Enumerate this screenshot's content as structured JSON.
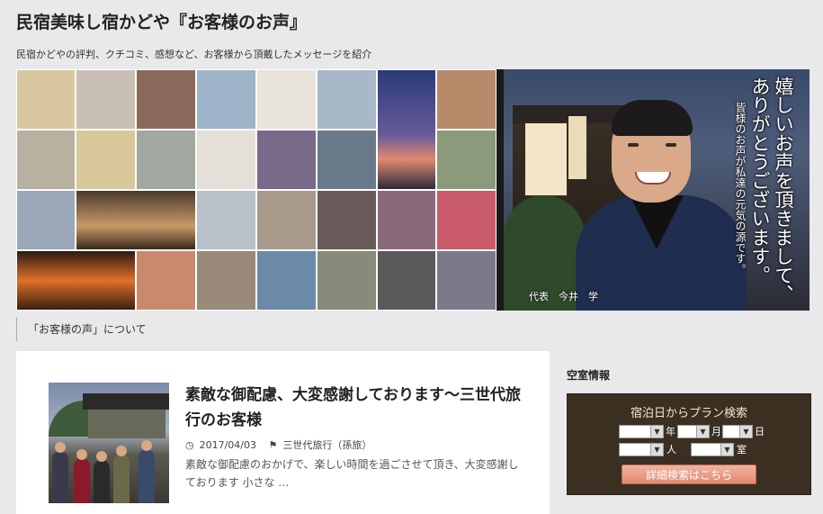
{
  "header": {
    "site_title": "民宿美味し宿かどや『お客様のお声』",
    "description": "民宿かどやの評判、クチコミ、感想など、お客様から頂戴したメッセージを紹介"
  },
  "banner": {
    "message_line1": "嬉しいお声を頂きまして、",
    "message_line2": "ありがとうございます。",
    "message_line3": "皆様のお声が私達の元気の源です。",
    "caption": "代表　今井　学"
  },
  "about_link": "「お客様の声」について",
  "post": {
    "title": "素敵な御配慮、大変感謝しております～三世代旅行のお客様",
    "date": "2017/04/03",
    "category": "三世代旅行（孫旅）",
    "excerpt": "素敵な御配慮のおかげで、楽しい時間を過ごさせて頂き、大変感謝しております 小さな …"
  },
  "sidebar": {
    "widget_title": "空室情報",
    "booking": {
      "title": "宿泊日からプラン検索",
      "unit_year": "年",
      "unit_month": "月",
      "unit_day": "日",
      "unit_people": "人",
      "unit_rooms": "室",
      "button": "詳細検索はこちら"
    }
  },
  "icons": {
    "clock": "clock-icon",
    "tag": "tag-icon"
  }
}
